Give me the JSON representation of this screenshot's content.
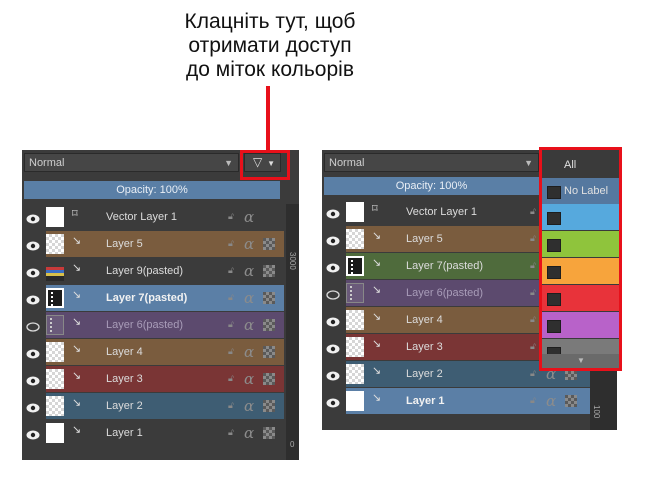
{
  "callout": {
    "lines": [
      "Клацніть тут, щоб",
      "отримати доступ",
      "до міток кольорів"
    ],
    "accent": "#e8101a"
  },
  "left": {
    "blend_mode": "Normal",
    "opacity": "Opacity:  100%",
    "ruler_label": "3000",
    "ruler_label2": "0",
    "layers": [
      {
        "name": "Vector Layer 1",
        "color": "none",
        "kind": "vector"
      },
      {
        "name": "Layer 5",
        "color": "#7a5c3e"
      },
      {
        "name": "Layer 9(pasted)",
        "color": "none"
      },
      {
        "name": "Layer 7(pasted)",
        "color": "#5b7fa6",
        "selected": true
      },
      {
        "name": "Layer 6(pasted)",
        "color": "#5c4a6e",
        "hidden": true
      },
      {
        "name": "Layer 4",
        "color": "#7a5c3e"
      },
      {
        "name": "Layer 3",
        "color": "#7a3535"
      },
      {
        "name": "Layer 2",
        "color": "#3e5d73"
      },
      {
        "name": "Layer 1",
        "color": "none"
      }
    ]
  },
  "right": {
    "blend_mode": "Normal",
    "opacity": "Opacity:  100%",
    "ruler_label": "100",
    "layers": [
      {
        "name": "Vector Layer 1",
        "color": "none",
        "kind": "vector"
      },
      {
        "name": "Layer 5",
        "color": "#7a5c3e"
      },
      {
        "name": "Layer 7(pasted)",
        "color": "#4f6b3c"
      },
      {
        "name": "Layer 6(pasted)",
        "color": "#5c4a6e",
        "hidden": true
      },
      {
        "name": "Layer 4",
        "color": "#7a5c3e"
      },
      {
        "name": "Layer 3",
        "color": "#7a3535"
      },
      {
        "name": "Layer 2",
        "color": "#3e5d73"
      },
      {
        "name": "Layer 1",
        "color": "#5b7fa6",
        "selected": true
      }
    ]
  },
  "filter_menu": {
    "all_label": "All",
    "no_label": "No Label",
    "colors": [
      "#56a9dd",
      "#8fc43c",
      "#f7a43c",
      "#e8333a",
      "#b862c9",
      "#7a7a7a"
    ]
  }
}
